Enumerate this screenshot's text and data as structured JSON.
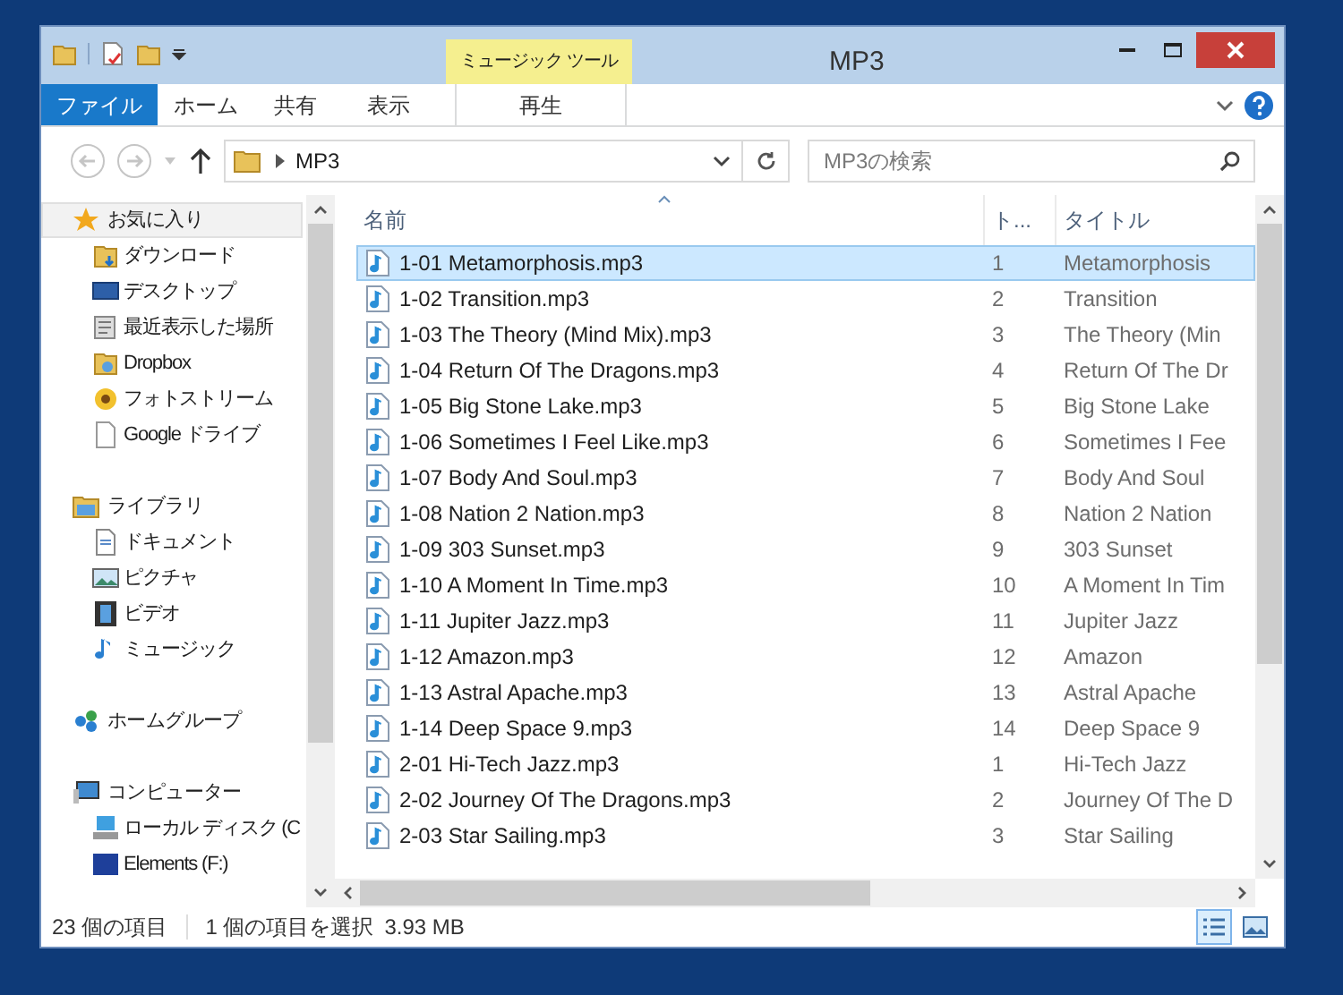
{
  "window": {
    "title": "MP3",
    "context_tab": "ミュージック ツール"
  },
  "ribbon_tabs": [
    {
      "label": "ファイル",
      "selected": true
    },
    {
      "label": "ホーム",
      "selected": false
    },
    {
      "label": "共有",
      "selected": false
    },
    {
      "label": "表示",
      "selected": false
    },
    {
      "label": "再生",
      "selected": false
    }
  ],
  "address": {
    "path": "MP3",
    "search_placeholder": "MP3の検索"
  },
  "nav": [
    {
      "label": "お気に入り",
      "selected": true,
      "children": [
        {
          "label": "ダウンロード"
        },
        {
          "label": "デスクトップ"
        },
        {
          "label": "最近表示した場所"
        },
        {
          "label": "Dropbox"
        },
        {
          "label": "フォトストリーム"
        },
        {
          "label": "Google ドライブ"
        }
      ]
    },
    {
      "label": "ライブラリ",
      "selected": false,
      "children": [
        {
          "label": "ドキュメント"
        },
        {
          "label": "ピクチャ"
        },
        {
          "label": "ビデオ"
        },
        {
          "label": "ミュージック"
        }
      ]
    },
    {
      "label": "ホームグループ",
      "selected": false
    },
    {
      "label": "コンピューター",
      "selected": false,
      "children": [
        {
          "label": "ローカル ディスク (C"
        },
        {
          "label": "Elements (F:)"
        }
      ]
    }
  ],
  "table": {
    "columns": [
      "名前",
      "ト...",
      "タイトル"
    ],
    "rows": [
      {
        "name": "1-01 Metamorphosis.mp3",
        "track": "1",
        "title": "Metamorphosis",
        "selected": true
      },
      {
        "name": "1-02 Transition.mp3",
        "track": "2",
        "title": "Transition",
        "selected": false
      },
      {
        "name": "1-03 The Theory (Mind Mix).mp3",
        "track": "3",
        "title": "The Theory (Min",
        "selected": false
      },
      {
        "name": "1-04 Return Of The Dragons.mp3",
        "track": "4",
        "title": "Return Of The Dr",
        "selected": false
      },
      {
        "name": "1-05 Big Stone Lake.mp3",
        "track": "5",
        "title": "Big Stone Lake",
        "selected": false
      },
      {
        "name": "1-06 Sometimes I Feel Like.mp3",
        "track": "6",
        "title": "Sometimes I Fee",
        "selected": false
      },
      {
        "name": "1-07 Body And Soul.mp3",
        "track": "7",
        "title": "Body And Soul",
        "selected": false
      },
      {
        "name": "1-08 Nation 2 Nation.mp3",
        "track": "8",
        "title": "Nation 2 Nation",
        "selected": false
      },
      {
        "name": "1-09 303 Sunset.mp3",
        "track": "9",
        "title": "303 Sunset",
        "selected": false
      },
      {
        "name": "1-10 A Moment In Time.mp3",
        "track": "10",
        "title": "A Moment In Tim",
        "selected": false
      },
      {
        "name": "1-11 Jupiter Jazz.mp3",
        "track": "11",
        "title": "Jupiter Jazz",
        "selected": false
      },
      {
        "name": "1-12 Amazon.mp3",
        "track": "12",
        "title": "Amazon",
        "selected": false
      },
      {
        "name": "1-13 Astral Apache.mp3",
        "track": "13",
        "title": "Astral Apache",
        "selected": false
      },
      {
        "name": "1-14 Deep Space 9.mp3",
        "track": "14",
        "title": "Deep Space 9",
        "selected": false
      },
      {
        "name": "2-01 Hi-Tech Jazz.mp3",
        "track": "1",
        "title": "Hi-Tech Jazz",
        "selected": false
      },
      {
        "name": "2-02 Journey Of The Dragons.mp3",
        "track": "2",
        "title": "Journey Of The D",
        "selected": false
      },
      {
        "name": "2-03 Star Sailing.mp3",
        "track": "3",
        "title": "Star Sailing",
        "selected": false
      }
    ]
  },
  "status_bar": {
    "item_count": "23 個の項目",
    "selection": "1 個の項目を選択",
    "size": "3.93 MB"
  }
}
